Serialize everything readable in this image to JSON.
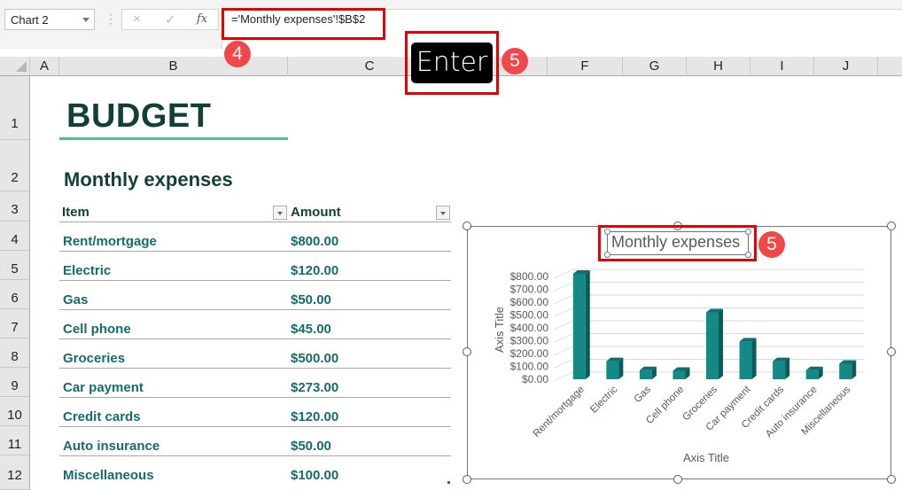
{
  "formula_bar": {
    "name_box": "Chart 2",
    "cancel_icon": "×",
    "enter_icon": "✓",
    "fx_label": "fx",
    "formula": "='Monthly expenses'!$B$2"
  },
  "annotations": {
    "step4": "4",
    "step5a": "5",
    "step5b": "5",
    "enter_key": "Enter"
  },
  "columns": [
    "A",
    "B",
    "C",
    "F",
    "G",
    "H",
    "I",
    "J"
  ],
  "rows": [
    "1",
    "2",
    "3",
    "4",
    "5",
    "6",
    "7",
    "8",
    "9",
    "10",
    "11",
    "12"
  ],
  "sheet": {
    "title": "BUDGET",
    "subtitle": "Monthly expenses",
    "headers": {
      "item": "Item",
      "amount": "Amount"
    },
    "items": [
      {
        "item": "Rent/mortgage",
        "amount": "$800.00"
      },
      {
        "item": "Electric",
        "amount": "$120.00"
      },
      {
        "item": "Gas",
        "amount": "$50.00"
      },
      {
        "item": "Cell phone",
        "amount": "$45.00"
      },
      {
        "item": "Groceries",
        "amount": "$500.00"
      },
      {
        "item": "Car payment",
        "amount": "$273.00"
      },
      {
        "item": "Credit cards",
        "amount": "$120.00"
      },
      {
        "item": "Auto insurance",
        "amount": "$50.00"
      },
      {
        "item": "Miscellaneous",
        "amount": "$100.00"
      }
    ]
  },
  "chart_data": {
    "type": "bar",
    "title": "Monthly expenses",
    "categories": [
      "Rent/mortgage",
      "Electric",
      "Gas",
      "Cell phone",
      "Groceries",
      "Car payment",
      "Credit cards",
      "Auto insurance",
      "Miscellaneous"
    ],
    "values": [
      800,
      120,
      50,
      45,
      500,
      273,
      120,
      50,
      100
    ],
    "xlabel": "Axis Title",
    "ylabel": "Axis Title",
    "ylim": [
      0,
      800
    ],
    "yticks": [
      "$0.00",
      "$100.00",
      "$200.00",
      "$300.00",
      "$400.00",
      "$500.00",
      "$600.00",
      "$700.00",
      "$800.00"
    ],
    "grid": true,
    "legend": "none",
    "style": "3d-column",
    "colors": {
      "front": "#138a86",
      "side": "#0b5c59",
      "top": "#0f6f6c"
    }
  }
}
